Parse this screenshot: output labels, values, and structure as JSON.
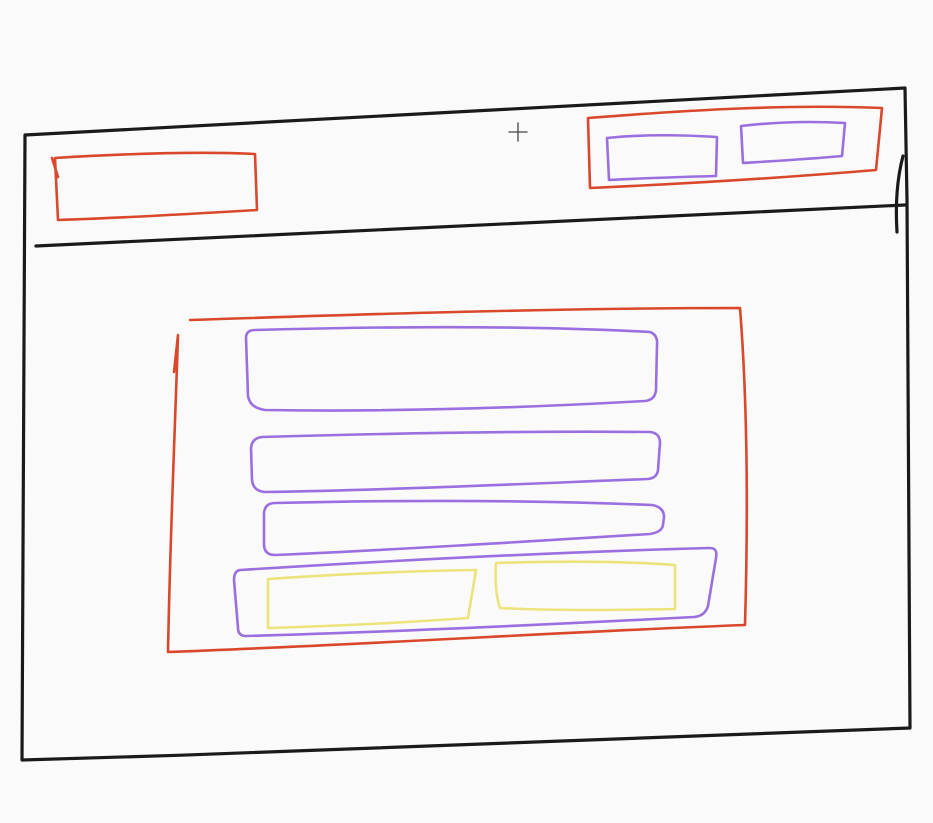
{
  "colors": {
    "outline": "#1a1a1a",
    "container": "#d9482b",
    "element": "#9b6fe0",
    "action": "#ece37a",
    "cursor": "#444444",
    "background": "#fafafa"
  },
  "sketch": {
    "window": {
      "role": "browser-window-frame"
    },
    "header": {
      "role": "top-header-bar"
    },
    "header_left_box": {
      "role": "logo-placeholder"
    },
    "header_right_group": {
      "role": "header-actions-group",
      "item_count": 2
    },
    "form_container": {
      "role": "central-form-card"
    },
    "form_rows": {
      "count": 3
    },
    "button_row": {
      "role": "form-buttons-row",
      "button_count": 2
    },
    "cursor": {
      "icon": "crosshair-cursor-icon"
    }
  }
}
